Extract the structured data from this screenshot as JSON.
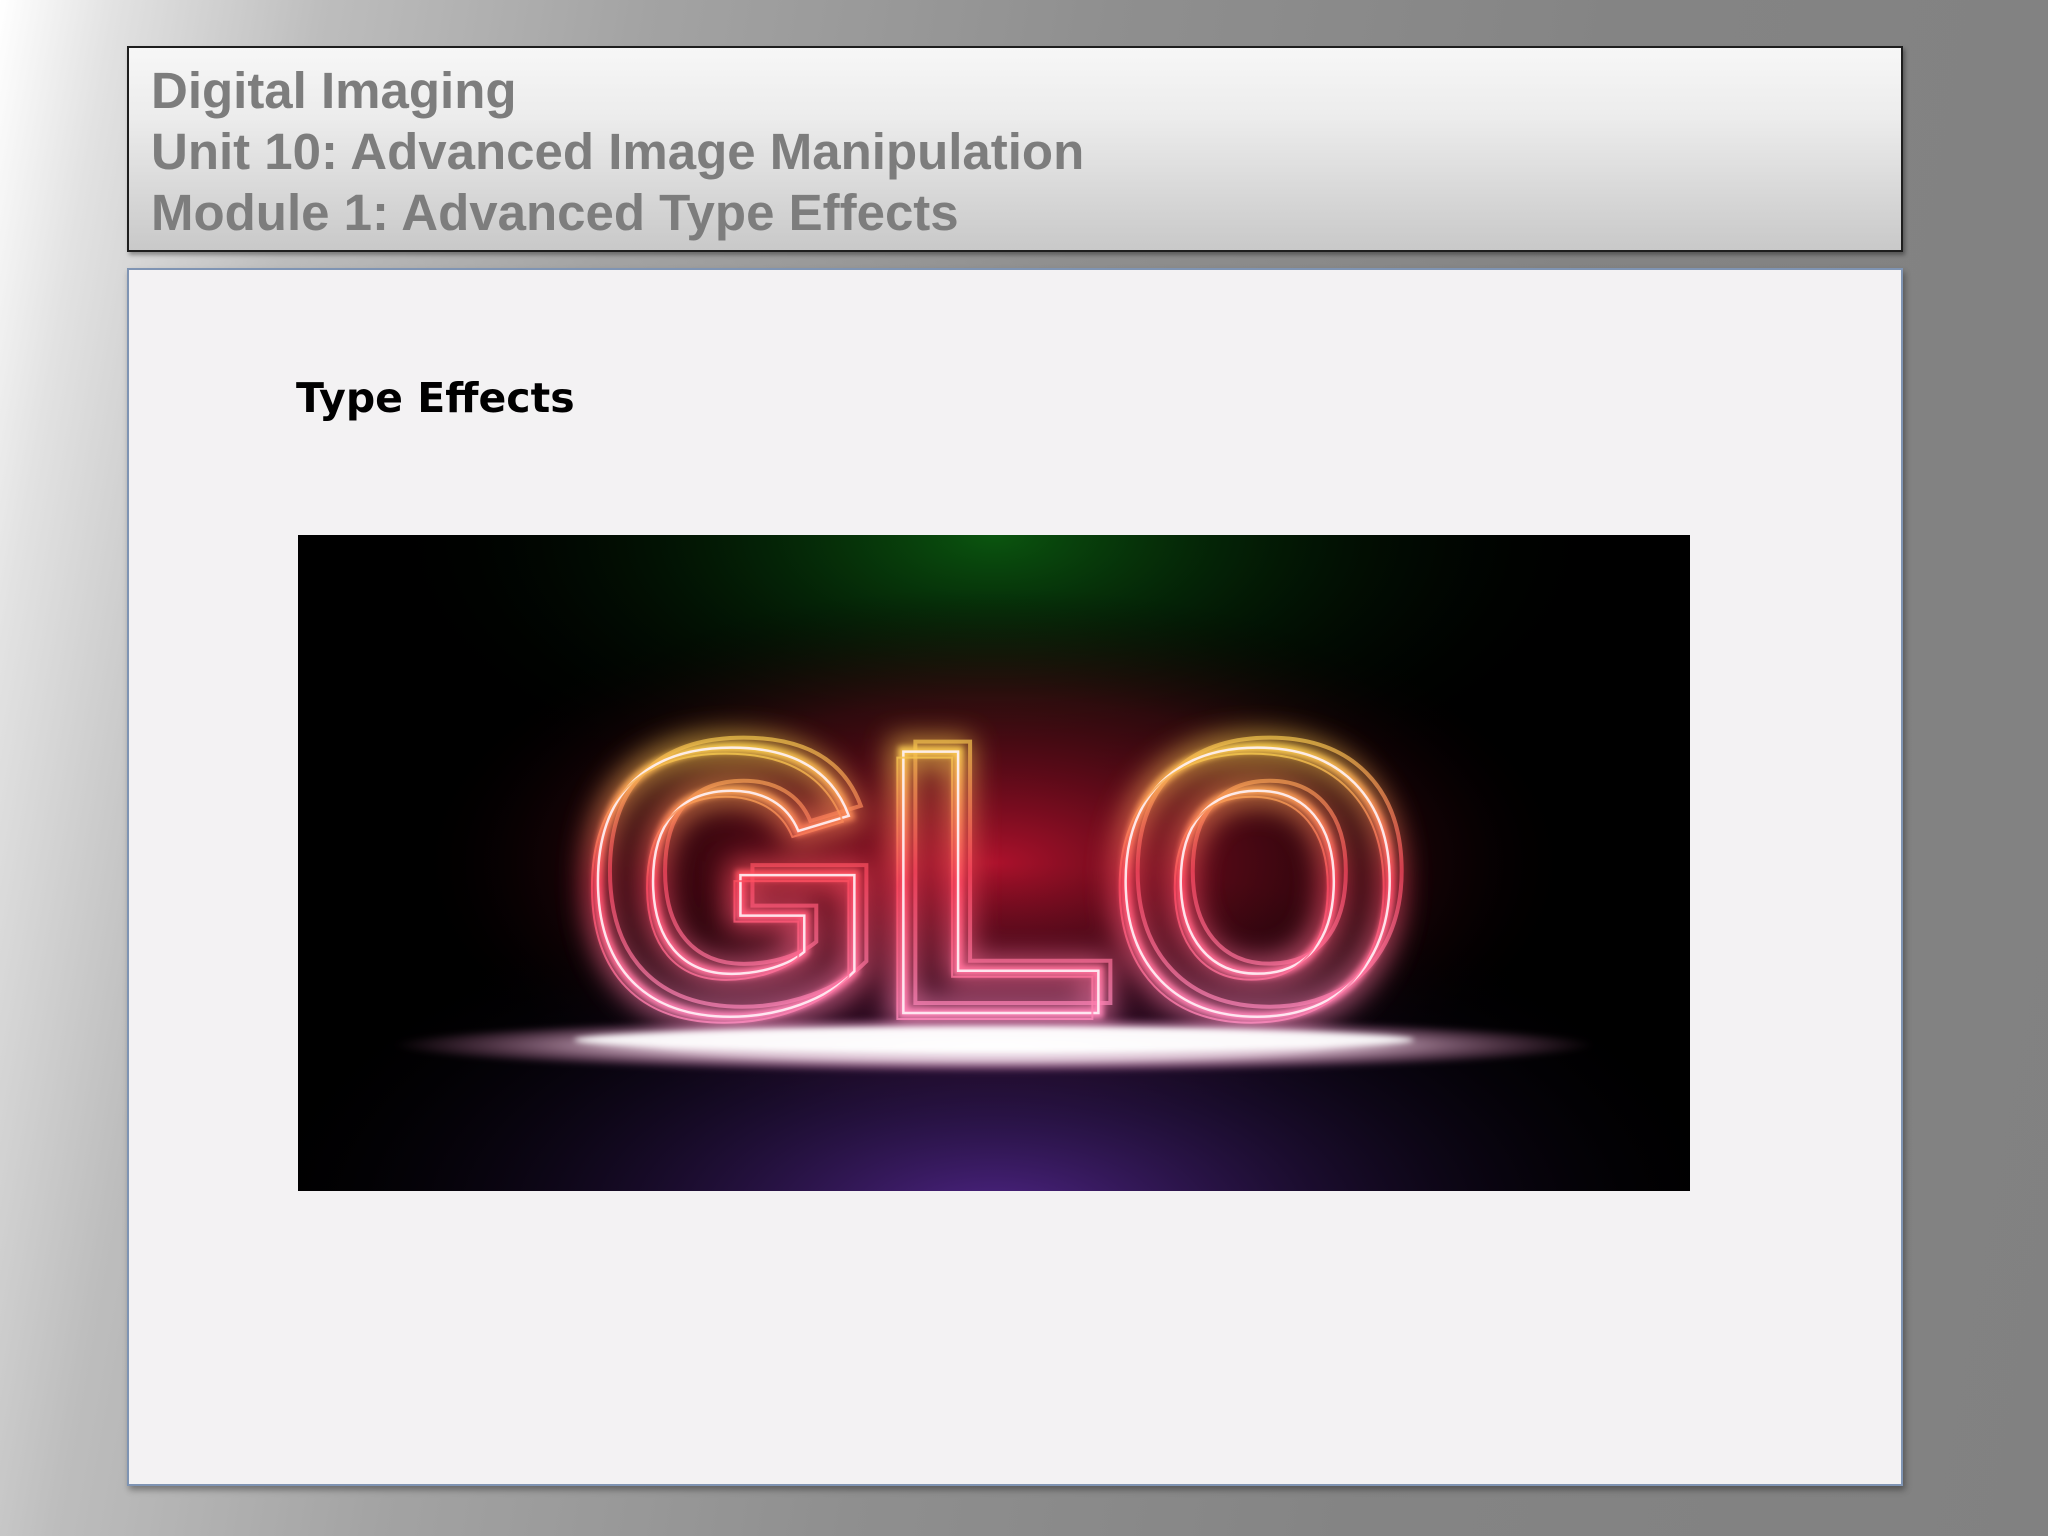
{
  "header": {
    "line1": "Digital Imaging",
    "line2": "Unit 10: Advanced Image Manipulation",
    "line3": "Module 1: Advanced Type Effects"
  },
  "content": {
    "heading": "Type Effects",
    "image": {
      "text": "GLO",
      "colors": {
        "top_glow": "#0b5a10",
        "center_glow": "#b5122e",
        "bottom_glow": "#5a2a9a",
        "outline_top": "#f4e24a",
        "outline_mid": "#ff4a62",
        "outline_bottom": "#ff9ad6"
      }
    }
  }
}
